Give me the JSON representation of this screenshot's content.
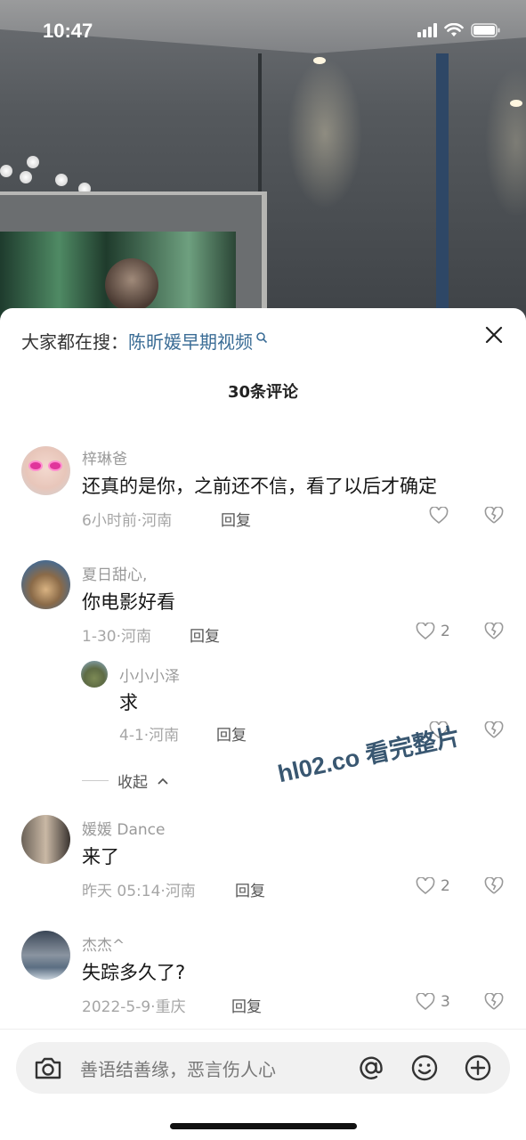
{
  "status_bar": {
    "time": "10:47"
  },
  "sheet": {
    "search_prefix": "大家都在搜：",
    "search_term": "陈昕媛早期视频",
    "comment_count": "30条评论",
    "close_icon": "close-icon"
  },
  "comments": [
    {
      "name": "梓琳爸",
      "text": "还真的是你，之前还不信，看了以后才确定",
      "time": "6小时前",
      "location": "河南",
      "reply": "回复",
      "likes": ""
    },
    {
      "name": "夏日甜心,",
      "text": "你电影好看",
      "time": "1-30",
      "location": "河南",
      "reply": "回复",
      "likes": "2"
    },
    {
      "name": "小小小泽",
      "text": "求",
      "time": "4-1",
      "location": "河南",
      "reply": "回复",
      "likes": ""
    },
    {
      "name": "媛媛 Dance",
      "text": "来了",
      "time": "昨天 05:14",
      "location": "河南",
      "reply": "回复",
      "likes": "2"
    },
    {
      "name": "杰杰^",
      "text": "失踪多久了?",
      "time": "2022-5-9",
      "location": "重庆",
      "reply": "回复",
      "likes": "3"
    }
  ],
  "collapse_label": "收起",
  "watermark": "hl02.co 看完整片",
  "input": {
    "placeholder": "善语结善缘，恶言伤人心",
    "icons": [
      "camera-icon",
      "at-icon",
      "emoji-icon",
      "plus-icon"
    ]
  },
  "meta_separator": "·"
}
